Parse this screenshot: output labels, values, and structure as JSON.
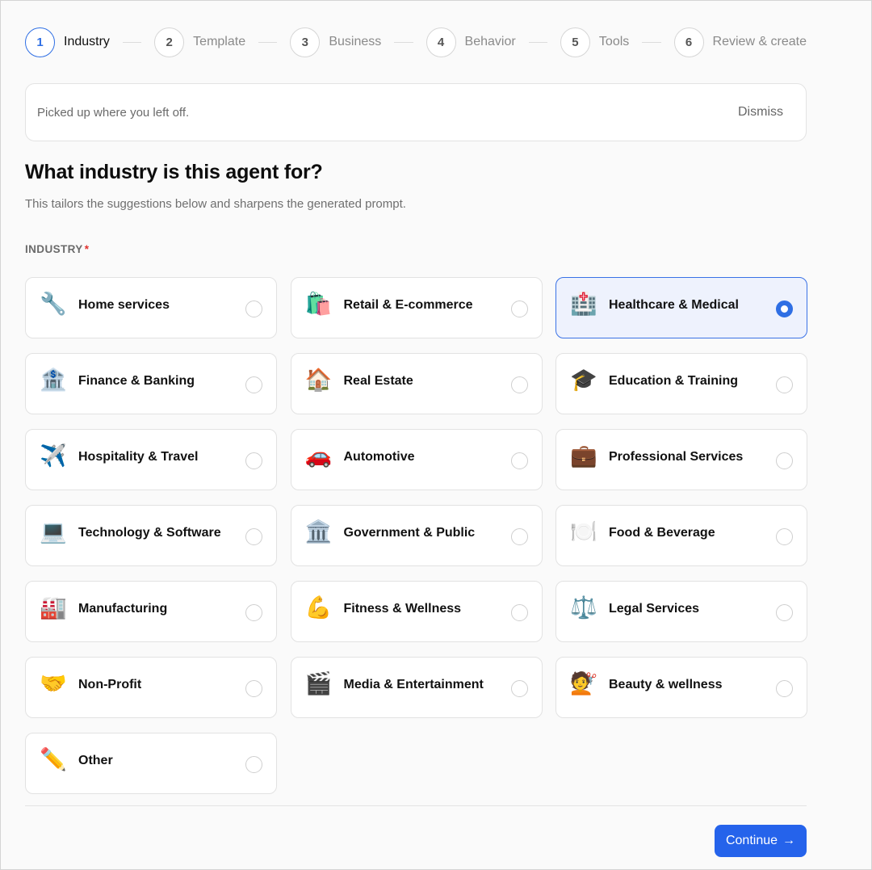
{
  "stepper": {
    "steps": [
      {
        "num": "1",
        "label": "Industry"
      },
      {
        "num": "2",
        "label": "Template"
      },
      {
        "num": "3",
        "label": "Business"
      },
      {
        "num": "4",
        "label": "Behavior"
      },
      {
        "num": "5",
        "label": "Tools"
      },
      {
        "num": "6",
        "label": "Review & create"
      }
    ],
    "active_index": 0
  },
  "banner": {
    "text": "Picked up where you left off.",
    "dismiss_label": "Dismiss"
  },
  "page": {
    "title": "What industry is this agent for?",
    "subtitle": "This tailors the suggestions below and sharpens the generated prompt.",
    "section_label": "INDUSTRY",
    "required_mark": "*"
  },
  "industries": [
    {
      "emoji": "🔧",
      "icon": "wrench-icon",
      "label": "Home services",
      "selected": false
    },
    {
      "emoji": "🛍️",
      "icon": "shopping-bags-icon",
      "label": "Retail & E-commerce",
      "selected": false
    },
    {
      "emoji": "🏥",
      "icon": "hospital-icon",
      "label": "Healthcare & Medical",
      "selected": true
    },
    {
      "emoji": "🏦",
      "icon": "bank-icon",
      "label": "Finance & Banking",
      "selected": false
    },
    {
      "emoji": "🏠",
      "icon": "house-icon",
      "label": "Real Estate",
      "selected": false
    },
    {
      "emoji": "🎓",
      "icon": "graduation-cap-icon",
      "label": "Education & Training",
      "selected": false
    },
    {
      "emoji": "✈️",
      "icon": "airplane-icon",
      "label": "Hospitality & Travel",
      "selected": false
    },
    {
      "emoji": "🚗",
      "icon": "car-icon",
      "label": "Automotive",
      "selected": false
    },
    {
      "emoji": "💼",
      "icon": "briefcase-icon",
      "label": "Professional Services",
      "selected": false
    },
    {
      "emoji": "💻",
      "icon": "laptop-icon",
      "label": "Technology & Software",
      "selected": false
    },
    {
      "emoji": "🏛️",
      "icon": "government-building-icon",
      "label": "Government & Public",
      "selected": false
    },
    {
      "emoji": "🍽️",
      "icon": "plate-cutlery-icon",
      "label": "Food & Beverage",
      "selected": false
    },
    {
      "emoji": "🏭",
      "icon": "factory-icon",
      "label": "Manufacturing",
      "selected": false
    },
    {
      "emoji": "💪",
      "icon": "flexed-biceps-icon",
      "label": "Fitness & Wellness",
      "selected": false
    },
    {
      "emoji": "⚖️",
      "icon": "scales-icon",
      "label": "Legal Services",
      "selected": false
    },
    {
      "emoji": "🤝",
      "icon": "handshake-icon",
      "label": "Non-Profit",
      "selected": false
    },
    {
      "emoji": "🎬",
      "icon": "clapper-board-icon",
      "label": "Media & Entertainment",
      "selected": false
    },
    {
      "emoji": "💇",
      "icon": "haircut-icon",
      "label": "Beauty & wellness",
      "selected": false
    },
    {
      "emoji": "✏️",
      "icon": "pencil-icon",
      "label": "Other",
      "selected": false
    }
  ],
  "footer": {
    "continue_label": "Continue",
    "continue_arrow": "→"
  },
  "colors": {
    "accent": "#2563eb",
    "selected_bg": "#eef2fd",
    "required": "#e0322f"
  }
}
